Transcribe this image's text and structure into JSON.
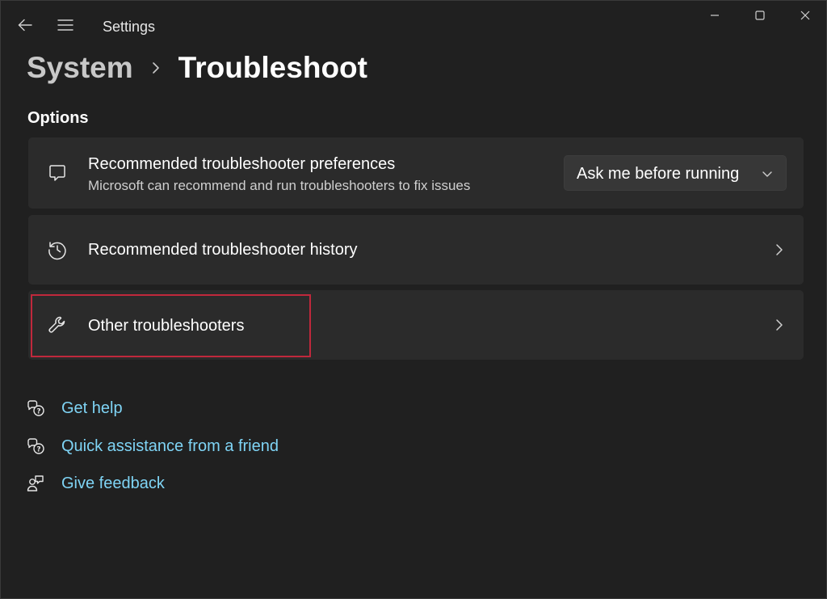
{
  "window": {
    "app_title": "Settings",
    "controls": {
      "minimize": "minimize-icon",
      "maximize": "maximize-icon",
      "close": "close-icon"
    }
  },
  "nav": {
    "back_icon": "back-arrow-icon",
    "menu_icon": "hamburger-menu-icon"
  },
  "breadcrumb": {
    "parent": "System",
    "separator": "›",
    "current": "Troubleshoot"
  },
  "section": {
    "heading": "Options"
  },
  "cards": [
    {
      "icon": "chat-bubble-icon",
      "title": "Recommended troubleshooter preferences",
      "description": "Microsoft can recommend and run troubleshooters to fix issues",
      "dropdown_value": "Ask me before running"
    },
    {
      "icon": "history-icon",
      "title": "Recommended troubleshooter history"
    },
    {
      "icon": "wrench-icon",
      "title": "Other troubleshooters",
      "highlighted": true
    }
  ],
  "help_links": [
    {
      "icon": "help-chat-icon",
      "label": "Get help"
    },
    {
      "icon": "help-chat-icon",
      "label": "Quick assistance from a friend"
    },
    {
      "icon": "feedback-icon",
      "label": "Give feedback"
    }
  ],
  "colors": {
    "background": "#202020",
    "card": "#2b2b2b",
    "link": "#7fd4f5",
    "highlight": "#c0283c"
  }
}
